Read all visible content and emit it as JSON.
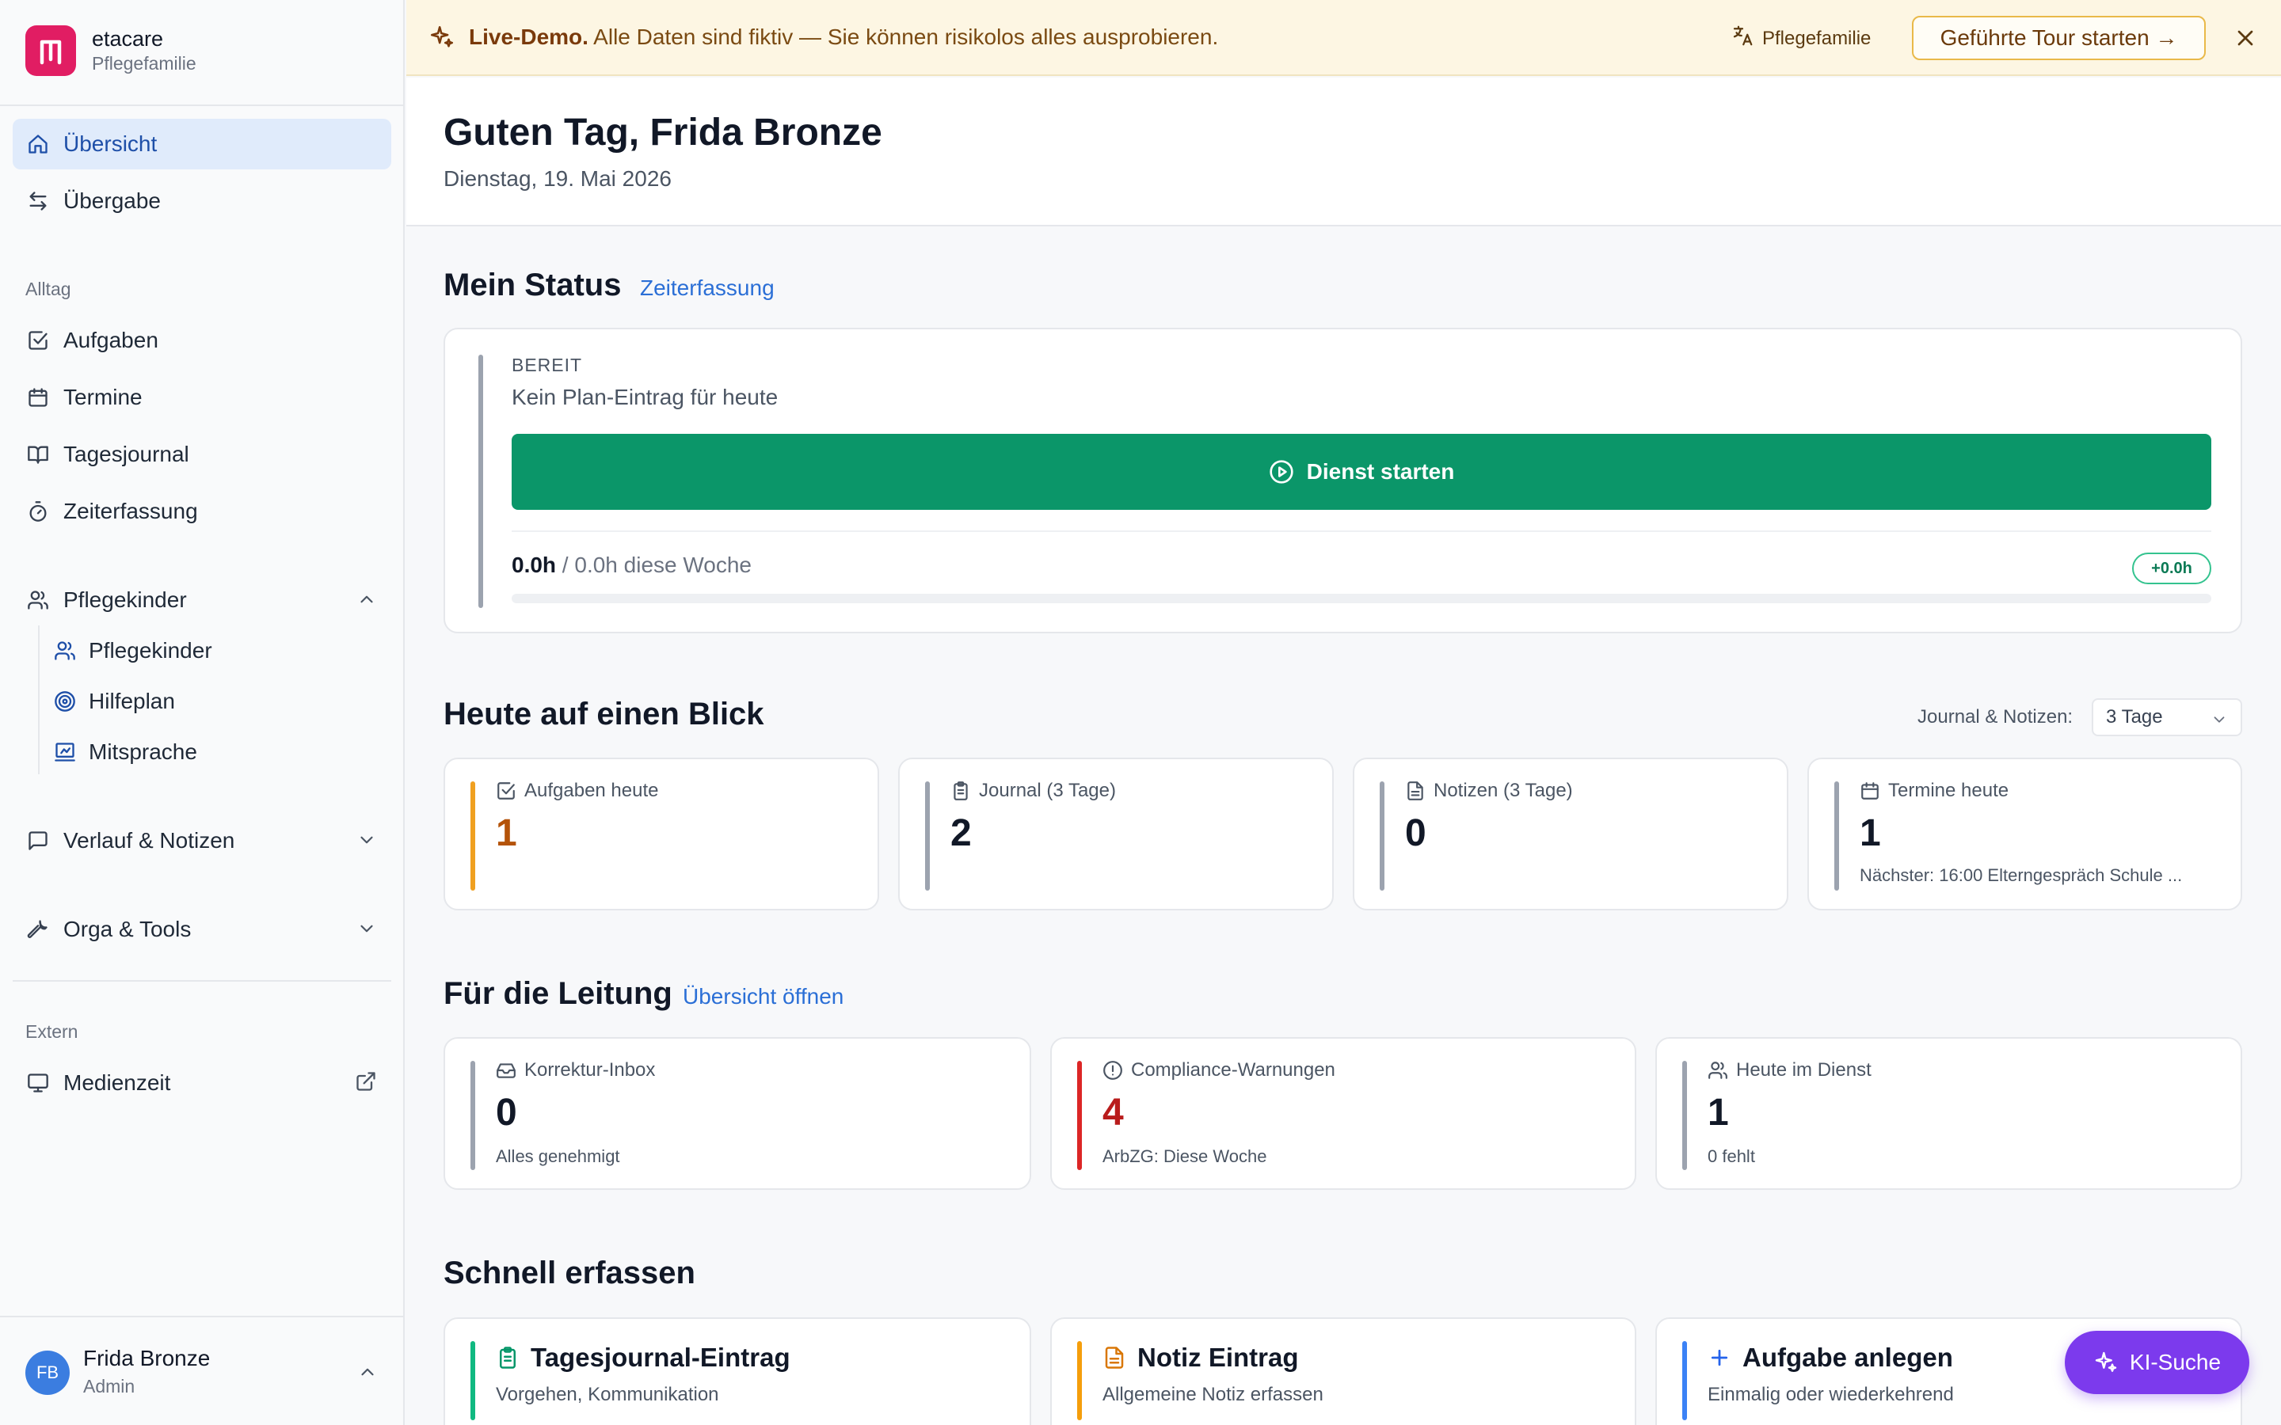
{
  "brand": {
    "name": "etacare",
    "subtitle": "Pflegefamilie",
    "logo_icon": "brand-logo-icon"
  },
  "sidebar": {
    "top_items": [
      {
        "label": "Übersicht",
        "icon": "home-icon",
        "active": true
      },
      {
        "label": "Übergabe",
        "icon": "swap-icon",
        "active": false
      }
    ],
    "group_alltag": "Alltag",
    "alltag_items": [
      {
        "label": "Aufgaben",
        "icon": "checkbox-icon"
      },
      {
        "label": "Termine",
        "icon": "calendar-icon"
      },
      {
        "label": "Tagesjournal",
        "icon": "book-icon"
      },
      {
        "label": "Zeiterfassung",
        "icon": "timer-icon"
      }
    ],
    "pflegekinder": {
      "label": "Pflegekinder",
      "expanded": true,
      "children": [
        {
          "label": "Pflegekinder",
          "icon": "users-icon"
        },
        {
          "label": "Hilfeplan",
          "icon": "target-icon"
        },
        {
          "label": "Mitsprache",
          "icon": "presentation-icon"
        }
      ]
    },
    "verlauf_label": "Verlauf & Notizen",
    "orga_label": "Orga & Tools",
    "group_extern": "Extern",
    "extern_items": [
      {
        "label": "Medienzeit",
        "icon": "monitor-icon",
        "external": true
      }
    ]
  },
  "user": {
    "initials": "FB",
    "name": "Frida Bronze",
    "role": "Admin"
  },
  "banner": {
    "highlight": "Live-Demo.",
    "text": "Alle Daten sind fiktiv — Sie können risikolos alles ausprobieren.",
    "lang_label": "Pflegefamilie",
    "tour_button": "Geführte Tour starten →",
    "colors": {
      "background": "#fdf6e3",
      "accent": "#e9b949"
    }
  },
  "header": {
    "greeting": "Guten Tag, Frida Bronze",
    "date": "Dienstag, 19. Mai 2026"
  },
  "status": {
    "title": "Mein Status",
    "link": "Zeiterfassung",
    "state": "BEREIT",
    "plan_text": "Kein Plan-Eintrag für heute",
    "start_button": "Dienst starten",
    "hours_done": "0.0h",
    "hours_rest": " / 0.0h diese Woche",
    "delta_badge": "+0.0h",
    "progress_fraction": 0,
    "colors": {
      "button": "#0b9669"
    }
  },
  "today": {
    "title": "Heute auf einen Blick",
    "filter_label": "Journal & Notizen:",
    "filter_value": "3 Tage",
    "cards": [
      {
        "label": "Aufgaben heute",
        "value": "1",
        "sub": "",
        "icon": "checkbox-icon",
        "accent": "#f0a020",
        "value_color": "#b45309"
      },
      {
        "label": "Journal (3 Tage)",
        "value": "2",
        "sub": "",
        "icon": "clipboard-icon",
        "accent": "#9ca3af",
        "value_color": "#111827"
      },
      {
        "label": "Notizen (3 Tage)",
        "value": "0",
        "sub": "",
        "icon": "document-icon",
        "accent": "#9ca3af",
        "value_color": "#111827"
      },
      {
        "label": "Termine heute",
        "value": "1",
        "sub": "Nächster: 16:00 Elterngespräch Schule ...",
        "icon": "calendar-icon",
        "accent": "#9ca3af",
        "value_color": "#111827"
      }
    ]
  },
  "leitung": {
    "title": "Für die Leitung",
    "link": "Übersicht öffnen",
    "cards": [
      {
        "label": "Korrektur-Inbox",
        "value": "0",
        "sub": "Alles genehmigt",
        "icon": "inbox-icon",
        "accent": "#9ca3af",
        "value_color": "#111827"
      },
      {
        "label": "Compliance-Warnungen",
        "value": "4",
        "sub": "ArbZG: Diese Woche",
        "icon": "alert-icon",
        "accent": "#dc2626",
        "value_color": "#b91c1c"
      },
      {
        "label": "Heute im Dienst",
        "value": "1",
        "sub": "0 fehlt",
        "icon": "users-icon",
        "accent": "#9ca3af",
        "value_color": "#111827"
      }
    ]
  },
  "quick": {
    "title": "Schnell erfassen",
    "cards": [
      {
        "label": "Tagesjournal-Eintrag",
        "sub": "Vorgehen, Kommunikation",
        "icon": "clipboard-icon",
        "accent": "#10b981"
      },
      {
        "label": "Notiz Eintrag",
        "sub": "Allgemeine Notiz erfassen",
        "icon": "document-icon",
        "accent": "#f59e0b"
      },
      {
        "label": "Aufgabe anlegen",
        "sub": "Einmalig oder wiederkehrend",
        "icon": "plus-icon",
        "accent": "#3b82f6"
      }
    ]
  },
  "ki_button": {
    "label": "KI-Suche",
    "icon": "sparkle-icon",
    "color": "#7c3aed"
  }
}
